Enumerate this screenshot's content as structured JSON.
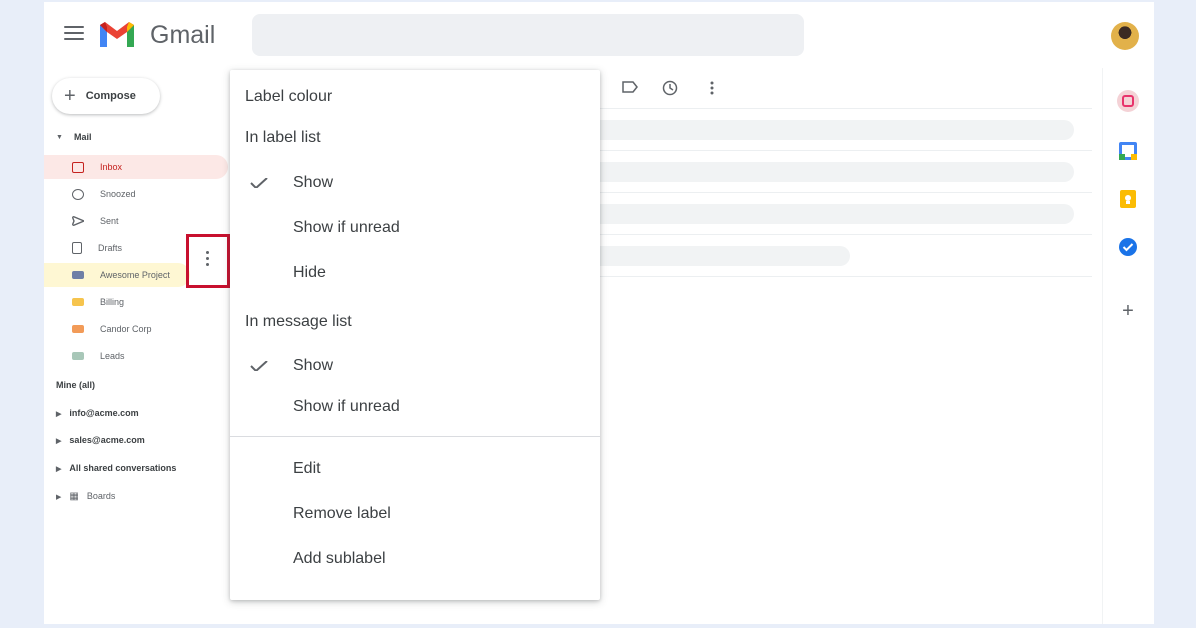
{
  "header": {
    "brand": "Gmail"
  },
  "sidebar": {
    "compose_label": "Compose",
    "mail_section": "Mail",
    "items": [
      {
        "label": "Inbox",
        "active": true
      },
      {
        "label": "Snoozed"
      },
      {
        "label": "Sent"
      },
      {
        "label": "Drafts"
      },
      {
        "label": "Awesome Project"
      },
      {
        "label": "Billing"
      },
      {
        "label": "Candor Corp"
      },
      {
        "label": "Leads"
      }
    ],
    "inboxes_section": "Mine (all)",
    "accounts": [
      {
        "label": "info@acme.com"
      },
      {
        "label": "sales@acme.com"
      },
      {
        "label": "All shared conversations"
      },
      {
        "label": "Boards"
      }
    ]
  },
  "menu": {
    "label_colour": "Label colour",
    "in_label_list": "In label list",
    "label_list_options": [
      {
        "label": "Show",
        "checked": true
      },
      {
        "label": "Show if unread"
      },
      {
        "label": "Hide"
      }
    ],
    "in_message_list": "In message list",
    "message_list_options": [
      {
        "label": "Show",
        "checked": true
      },
      {
        "label": "Show if unread"
      }
    ],
    "actions": [
      {
        "label": "Edit"
      },
      {
        "label": "Remove label"
      },
      {
        "label": "Add sublabel"
      }
    ]
  },
  "icons": {
    "hamburger": "hamburger-icon",
    "logo": "gmail-logo-icon",
    "three_dot": "more-vert-icon",
    "label": "label-icon",
    "snooze": "snooze-icon",
    "more": "more-vert-icon"
  },
  "colors": {
    "accent_red": "#c5221f",
    "highlight_frame": "#c8102e",
    "label_highlight": "#fef7d3",
    "tag_billing": "#f6c44d",
    "tag_candor": "#f29b58",
    "tag_leads": "#a8c7b8",
    "tag_awesome": "#6f7fa6"
  }
}
